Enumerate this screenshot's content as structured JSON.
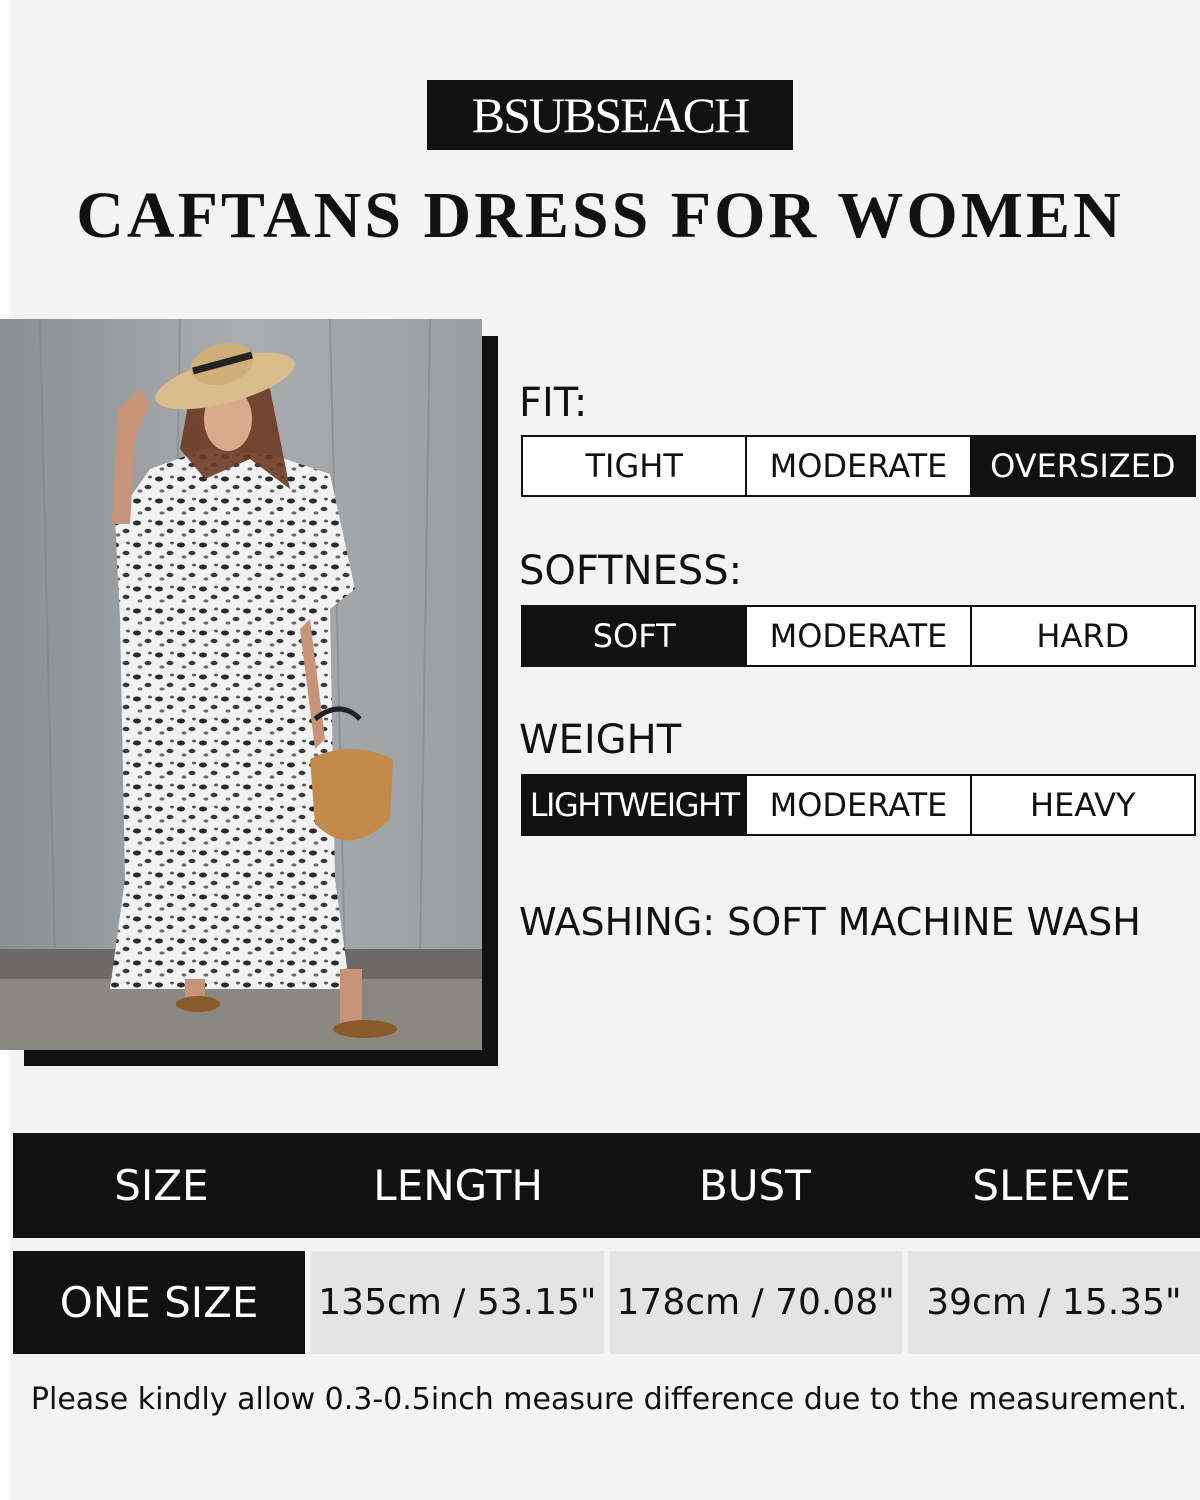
{
  "brand": "BSUBSEACH",
  "headline": "CAFTANS DRESS FOR WOMEN",
  "photo": {
    "alt_icon": "model-photo-icon"
  },
  "attributes": {
    "fit": {
      "label": "FIT:",
      "options": [
        "TIGHT",
        "MODERATE",
        "OVERSIZED"
      ],
      "selected": "OVERSIZED"
    },
    "softness": {
      "label": "SOFTNESS:",
      "options": [
        "SOFT",
        "MODERATE",
        "HARD"
      ],
      "selected": "SOFT"
    },
    "weight": {
      "label": "WEIGHT",
      "options": [
        "LIGHTWEIGHT",
        "MODERATE",
        "HEAVY"
      ],
      "selected": "LIGHTWEIGHT"
    }
  },
  "washing": "WASHING: SOFT MACHINE WASH",
  "size_table": {
    "headers": [
      "SIZE",
      "LENGTH",
      "BUST",
      "SLEEVE"
    ],
    "row": [
      "ONE SIZE",
      "135cm / 53.15\"",
      "178cm / 70.08\"",
      "39cm / 15.35\""
    ]
  },
  "note": "Please kindly allow 0.3-0.5inch measure difference due to the measurement.",
  "colors": {
    "ink": "#111111",
    "background": "#f4f4f4",
    "cell": "#e4e4e4"
  }
}
